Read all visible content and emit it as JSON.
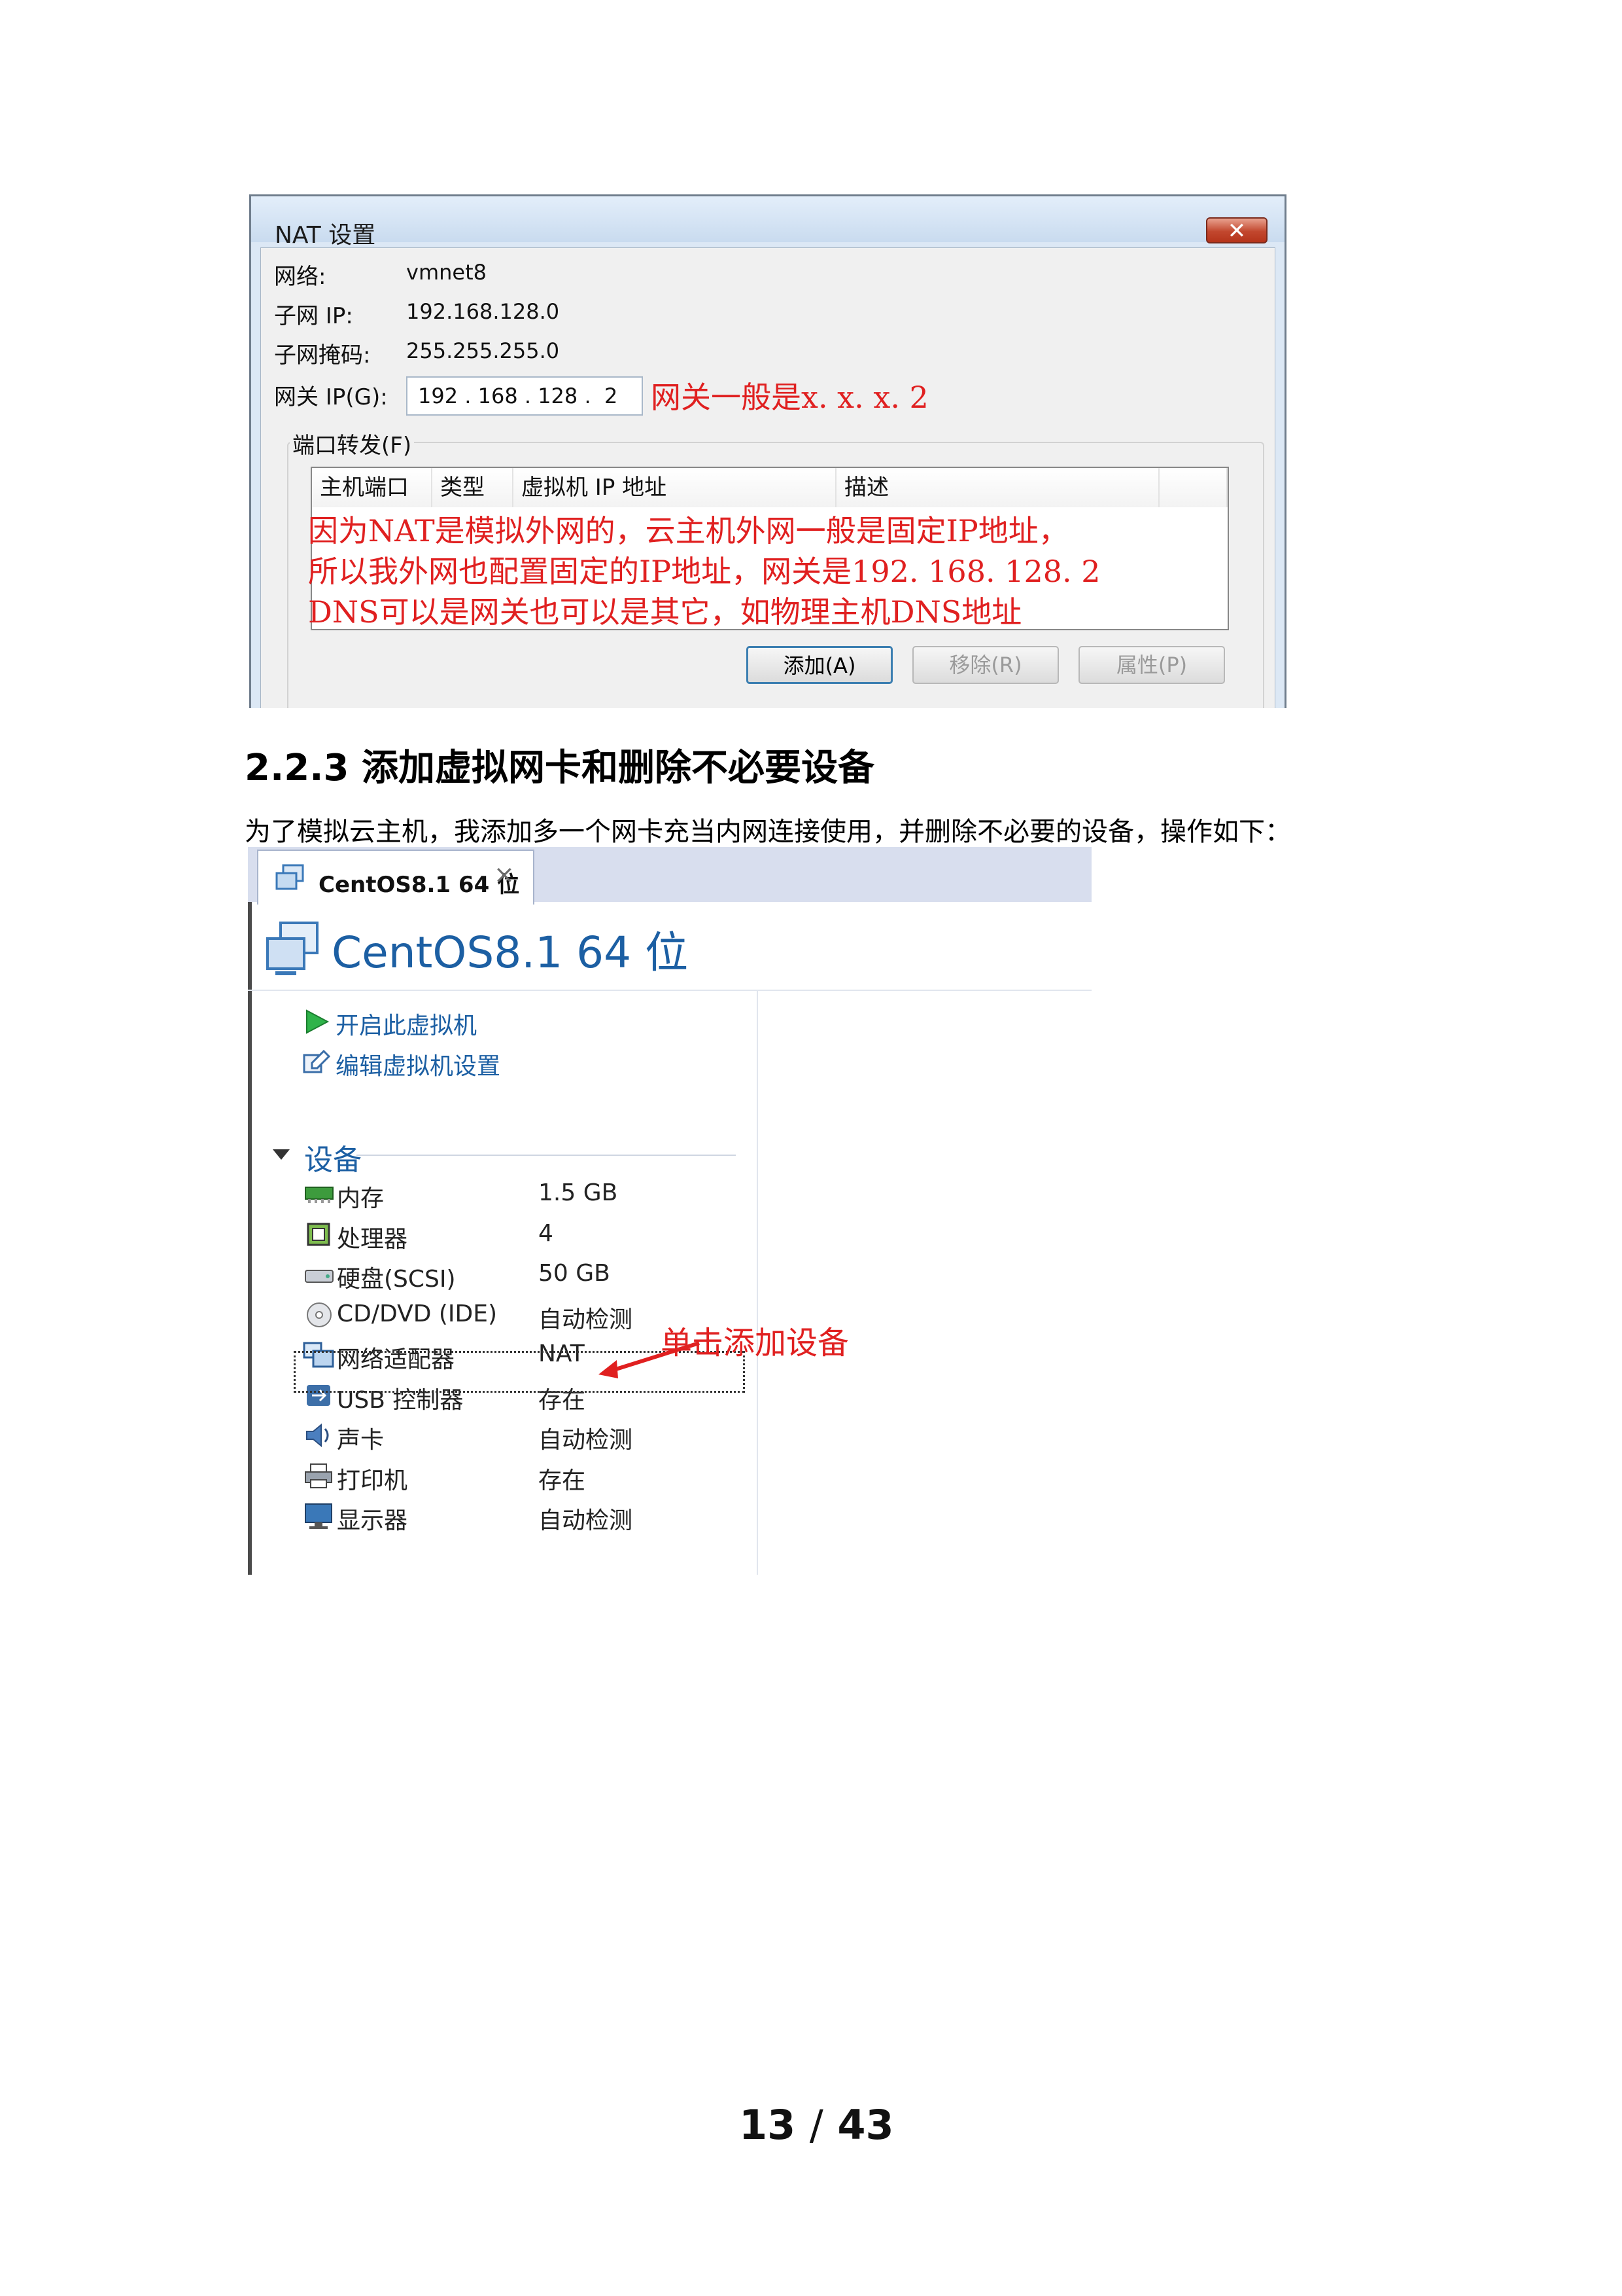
{
  "nat_dialog": {
    "title": "NAT 设置",
    "close_symbol": "✕",
    "network_label": "网络:",
    "network_value": "vmnet8",
    "subnet_ip_label": "子网 IP:",
    "subnet_ip_value": "192.168.128.0",
    "subnet_mask_label": "子网掩码:",
    "subnet_mask_value": "255.255.255.0",
    "gateway_label": "网关 IP(G):",
    "gateway_value": "192 . 168 . 128 .  2",
    "gateway_note": "网关一般是x. x. x. 2",
    "port_forward_label": "端口转发(F)",
    "columns": [
      "主机端口",
      "类型",
      "虚拟机 IP 地址",
      "描述"
    ],
    "notes": [
      "因为NAT是模拟外网的，云主机外网一般是固定IP地址，",
      "所以我外网也配置固定的IP地址，网关是192. 168. 128. 2",
      "DNS可以是网关也可以是其它，如物理主机DNS地址"
    ],
    "buttons": {
      "add": "添加(A)",
      "remove": "移除(R)",
      "properties": "属性(P)"
    }
  },
  "section": {
    "heading": "2.2.3 添加虚拟网卡和删除不必要设备",
    "paragraph": "为了模拟云主机，我添加多一个网卡充当内网连接使用，并删除不必要的设备，操作如下："
  },
  "vmware": {
    "tab_label": "CentOS8.1 64 位",
    "tab_close": "×",
    "vm_title": "CentOS8.1 64 位",
    "actions": [
      "开启此虚拟机",
      "编辑虚拟机设置"
    ],
    "devices_title": "设备",
    "devices": [
      {
        "icon": "memory-icon",
        "name": "内存",
        "value": "1.5 GB"
      },
      {
        "icon": "processor-icon",
        "name": "处理器",
        "value": "4"
      },
      {
        "icon": "hard-disk-icon",
        "name": "硬盘(SCSI)",
        "value": "50 GB"
      },
      {
        "icon": "cd-dvd-icon",
        "name": "CD/DVD (IDE)",
        "value": "自动检测"
      },
      {
        "icon": "network-adapter-icon",
        "name": "网络适配器",
        "value": "NAT"
      },
      {
        "icon": "usb-icon",
        "name": "USB 控制器",
        "value": "存在"
      },
      {
        "icon": "sound-card-icon",
        "name": "声卡",
        "value": "自动检测"
      },
      {
        "icon": "printer-icon",
        "name": "打印机",
        "value": "存在"
      },
      {
        "icon": "display-icon",
        "name": "显示器",
        "value": "自动检测"
      }
    ],
    "annotation": "单击添加设备"
  },
  "footer": {
    "page_current": "13",
    "page_sep": "/",
    "page_total": "43"
  },
  "colors": {
    "annotation_red": "#e02020",
    "vmware_blue": "#1c5fa3"
  }
}
